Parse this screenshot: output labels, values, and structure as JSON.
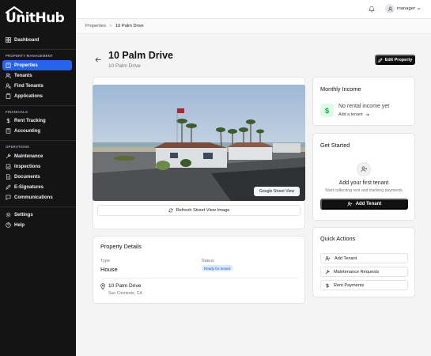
{
  "app": {
    "name": "UnitHub"
  },
  "sidebar": {
    "items_top": [
      {
        "label": "Dashboard",
        "icon": "dashboard-icon"
      }
    ],
    "section_property": "PROPERTY MANAGEMENT",
    "items_property": [
      {
        "label": "Properties",
        "icon": "building-icon",
        "active": true
      },
      {
        "label": "Tenants",
        "icon": "users-icon"
      },
      {
        "label": "Find Tenants",
        "icon": "user-search-icon"
      },
      {
        "label": "Applications",
        "icon": "clipboard-icon"
      }
    ],
    "section_financials": "FINANCIALS",
    "items_financials": [
      {
        "label": "Rent Tracking",
        "icon": "dollar-icon"
      },
      {
        "label": "Accounting",
        "icon": "calculator-icon"
      }
    ],
    "section_operations": "OPERATIONS",
    "items_operations": [
      {
        "label": "Maintenance",
        "icon": "wrench-icon"
      },
      {
        "label": "Inspections",
        "icon": "clipboard-check-icon"
      },
      {
        "label": "Documents",
        "icon": "file-icon"
      },
      {
        "label": "E-Signatures",
        "icon": "pen-icon"
      },
      {
        "label": "Communications",
        "icon": "message-icon"
      }
    ],
    "items_bottom": [
      {
        "label": "Settings",
        "icon": "gear-icon"
      },
      {
        "label": "Help",
        "icon": "help-circle-icon"
      }
    ]
  },
  "header": {
    "username": "manager"
  },
  "breadcrumb": {
    "root": "Properties",
    "separator": ">",
    "current": "10 Palm Drive"
  },
  "page": {
    "title": "10 Palm Drive",
    "subtitle": "10 Palm Drive",
    "edit_button": "Edit Property"
  },
  "photo": {
    "badge": "Google Street View",
    "refresh_button": "Refresh Street View Image"
  },
  "details": {
    "heading": "Property Details",
    "type_label": "Type",
    "type_value": "House",
    "status_label": "Status",
    "status_value": "Ready for tenant",
    "address_line1": "10 Palm Drive",
    "address_line2": "San Clemente, CA"
  },
  "income": {
    "heading": "Monthly Income",
    "empty_text": "No rental income yet",
    "add_link": "Add a tenant"
  },
  "get_started": {
    "heading": "Get Started",
    "title": "Add your first tenant",
    "subtitle": "Start collecting rent and tracking payments",
    "button": "Add Tenant"
  },
  "quick_actions": {
    "heading": "Quick Actions",
    "items": [
      {
        "label": "Add Tenant",
        "icon": "user-plus-icon"
      },
      {
        "label": "Maintenance Requests",
        "icon": "wrench-icon"
      },
      {
        "label": "Rent Payments",
        "icon": "dollar-icon"
      }
    ]
  },
  "colors": {
    "accent": "#2563eb",
    "sidebar_bg": "#141414",
    "badge_bg": "#dbeafe",
    "income_icon_bg": "#dcfce7"
  }
}
